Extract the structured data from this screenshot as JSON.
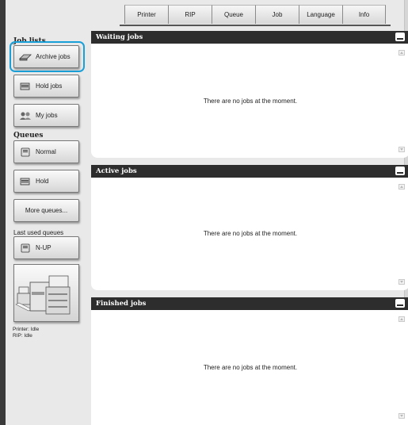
{
  "tabs": [
    "Printer",
    "RIP",
    "Queue",
    "Job",
    "Language",
    "Info"
  ],
  "sidebar": {
    "job_lists_title": "Job lists",
    "archive_jobs": "Archive jobs",
    "hold_jobs": "Hold jobs",
    "my_jobs": "My jobs",
    "queues_title": "Queues",
    "normal": "Normal",
    "hold": "Hold",
    "more_queues": "More queues...",
    "last_used_queues": "Last used queues",
    "nup": "N-UP",
    "printer_status": "Printer: Idle",
    "rip_status": "RIP: Idle"
  },
  "panels": {
    "waiting": {
      "title": "Waiting jobs",
      "message": "There are no jobs at the moment."
    },
    "active": {
      "title": "Active jobs",
      "message": "There are no jobs at the moment."
    },
    "finished": {
      "title": "Finished jobs",
      "message": "There are no jobs at the moment."
    }
  },
  "colors": {
    "focus_ring": "#1aa0d8",
    "header_bg": "#2d2d2d"
  }
}
